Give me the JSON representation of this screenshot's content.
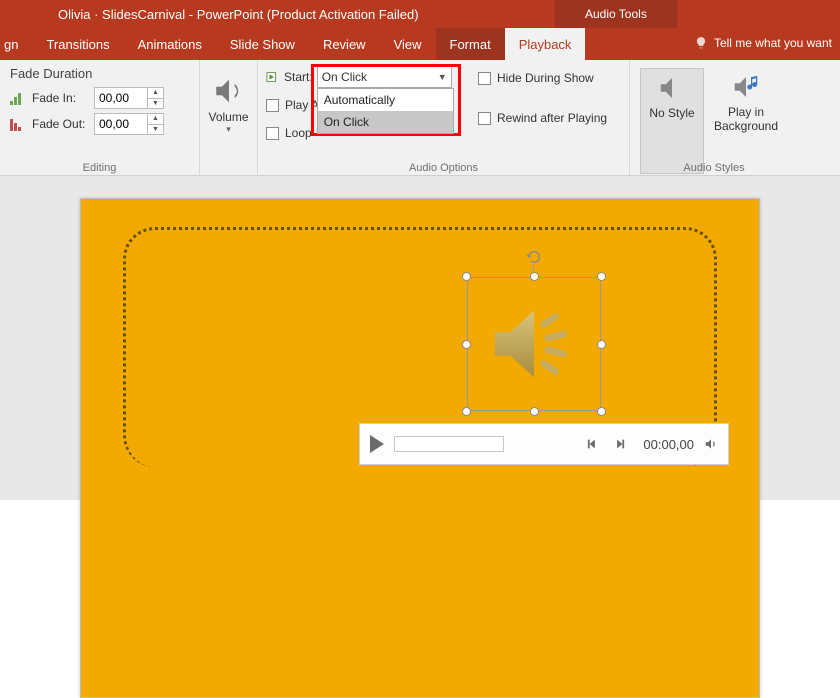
{
  "titlebar": {
    "title": "Olivia · SlidesCarnival - PowerPoint (Product Activation Failed)",
    "contextual": "Audio Tools"
  },
  "tabs": {
    "items": [
      "gn",
      "Transitions",
      "Animations",
      "Slide Show",
      "Review",
      "View",
      "Format",
      "Playback"
    ],
    "active": "Playback",
    "tellme": "Tell me what you want"
  },
  "ribbon": {
    "editing": {
      "title": "Fade Duration",
      "fade_in_label": "Fade In:",
      "fade_in_value": "00,00",
      "fade_out_label": "Fade Out:",
      "fade_out_value": "00,00",
      "group_label": "Editing"
    },
    "volume": {
      "label": "Volume"
    },
    "audio_options": {
      "start_label": "Start:",
      "start_value": "On Click",
      "options": [
        "Automatically",
        "On Click"
      ],
      "play_across": "Play A",
      "loop": "Loop",
      "hide": "Hide During Show",
      "rewind": "Rewind after Playing",
      "group_label": "Audio Options"
    },
    "audio_styles": {
      "no_style": "No Style",
      "play_bg": "Play in Background",
      "group_label": "Audio Styles"
    }
  },
  "player": {
    "time": "00:00,00"
  }
}
